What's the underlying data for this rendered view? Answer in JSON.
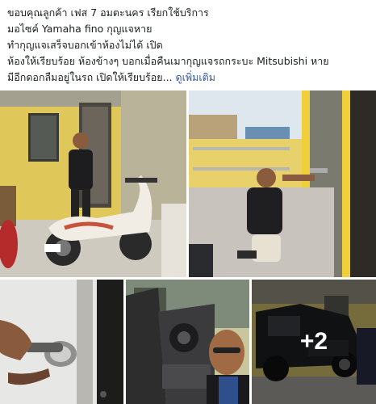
{
  "post": {
    "lines": [
      "ขอบคุณลูกค้า เฟส 7 อมตะนคร เรียกใช้บริการ",
      "มอไซค์ Yamaha fino กุญแจหาย",
      "ทำกุญแจเสร็จบอกเข้าห้องไม่ได้ เปิด",
      "ห้องให้เรียบร้อย ห้องข้างๆ บอกเมื่อคืนเมากุญแจรถกระบะ Mitsubishi หาย",
      "มีอีกดอกลืมอยู่ในรถ เปิดให้เรียบร้อย..."
    ],
    "see_more": "ดูเพิ่มเติม"
  },
  "photos": {
    "more_count": "+2"
  }
}
